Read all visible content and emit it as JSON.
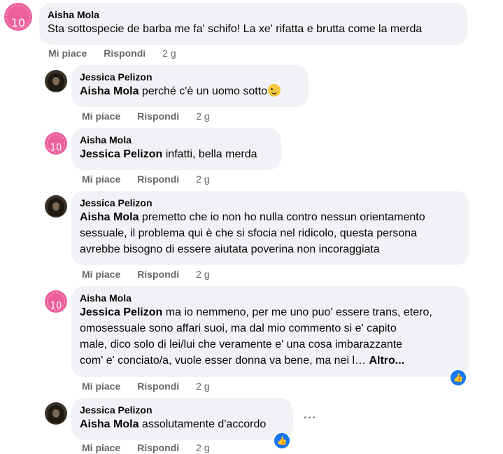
{
  "comments": [
    {
      "author": "Aisha Mola",
      "mention": "",
      "text": "Sta sottospecie de barba me fa' schifo! La xe' rifatta e brutta come la merda",
      "actions": {
        "like": "Mi piace",
        "reply": "Rispondi",
        "time": "2 g"
      },
      "avatar": "pink-10-avatar"
    },
    {
      "author": "Jessica Pelizon",
      "mention": "Aisha Mola",
      "text": "perché c'è un uomo sotto",
      "emoji": "winking-face",
      "actions": {
        "like": "Mi piace",
        "reply": "Rispondi",
        "time": "2 g"
      },
      "avatar": "dark-photo-avatar"
    },
    {
      "author": "Aisha Mola",
      "mention": "Jessica Pelizon",
      "text": "infatti, bella merda",
      "actions": {
        "like": "Mi piace",
        "reply": "Rispondi",
        "time": "2 g"
      },
      "avatar": "pink-10-avatar"
    },
    {
      "author": "Jessica Pelizon",
      "mention": "Aisha Mola",
      "text_lines": [
        "premetto che io non ho nulla contro nessun orientamento",
        "sessuale, il problema qui è che si sfocia nel ridicolo, questa persona",
        "avrebbe bisogno di essere aiutata poverina non incoraggiata"
      ],
      "actions": {
        "like": "Mi piace",
        "reply": "Rispondi",
        "time": "2 g"
      },
      "avatar": "dark-photo-avatar"
    },
    {
      "author": "Aisha Mola",
      "mention": "Jessica Pelizon",
      "text_lines": [
        "ma io nemmeno, per me uno puo' essere trans, etero,",
        "omosessuale sono affari suoi, ma dal mio commento si e' capito",
        "male, dico solo di lei/lui che veramente e' una cosa imbarazzante",
        "com' e' conciato/a, vuole esser donna va bene, ma nei l…"
      ],
      "more": "Altro...",
      "reaction": "like",
      "actions": {
        "like": "Mi piace",
        "reply": "Rispondi",
        "time": "2 g"
      },
      "avatar": "pink-10-avatar"
    },
    {
      "author": "Jessica Pelizon",
      "mention": "Aisha Mola",
      "text": "assolutamente d'accordo",
      "reaction": "like",
      "actions": {
        "like": "Mi piace",
        "reply": "Rispondi",
        "time": "2 g"
      },
      "avatar": "dark-photo-avatar"
    }
  ],
  "avatar_text": "10",
  "like_glyph": "👍",
  "menu_glyph": "···",
  "colors": {
    "bubble": "#f0f2f5",
    "meta": "#65676b",
    "like_blue": "#1877f2",
    "avatar_pink": "#ec5f9a"
  }
}
